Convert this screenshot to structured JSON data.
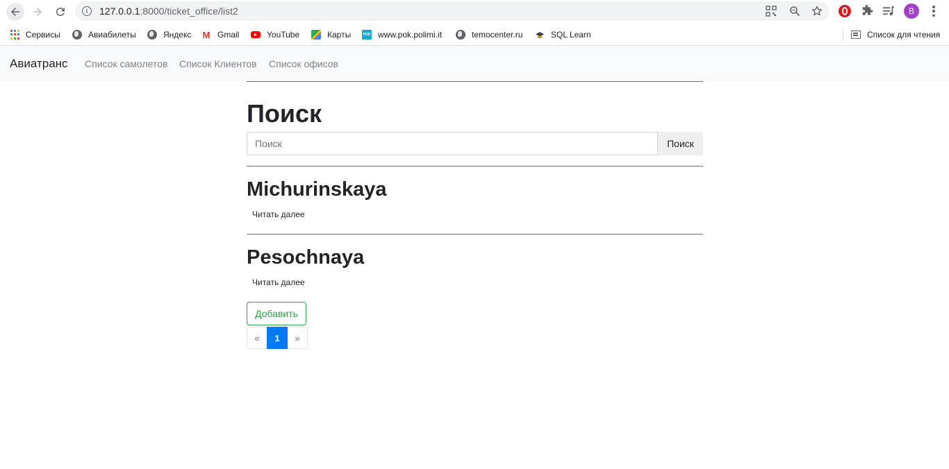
{
  "browser": {
    "url_host": "127.0.0.1",
    "url_path": ":8000/ticket_office/list2",
    "profile_initial": "B",
    "icons": [
      "back-icon",
      "forward-icon",
      "reload-icon",
      "info-icon",
      "qr-code-icon",
      "zoom-icon",
      "star-icon",
      "opera-icon",
      "extensions-icon",
      "media-icon",
      "menu-icon"
    ]
  },
  "bookmarks": [
    {
      "label": "Сервисы",
      "icon": "apps-grid-icon"
    },
    {
      "label": "Авиабилеты",
      "icon": "globe-icon"
    },
    {
      "label": "Яндекс",
      "icon": "globe-icon"
    },
    {
      "label": "Gmail",
      "icon": "gmail-icon"
    },
    {
      "label": "YouTube",
      "icon": "youtube-icon"
    },
    {
      "label": "Карты",
      "icon": "maps-icon"
    },
    {
      "label": "www.pok.polimi.it",
      "icon": "pok-icon",
      "icon_text": "POK"
    },
    {
      "label": "temocenter.ru",
      "icon": "globe-icon"
    },
    {
      "label": "SQL Learn",
      "icon": "graduation-cap-icon"
    }
  ],
  "reading_list": {
    "label": "Список для чтения",
    "icon": "reading-list-icon"
  },
  "navbar": {
    "brand": "Авиатранс",
    "links": [
      "Список самолетов",
      "Список Клиентов",
      "Список офисов"
    ]
  },
  "page": {
    "title": "Поиск",
    "search_placeholder": "Поиск",
    "search_button": "Поиск",
    "offices": [
      {
        "name": "Michurinskaya",
        "link": "Читать далее"
      },
      {
        "name": "Pesochnaya",
        "link": "Читать далее"
      }
    ],
    "add_button": "Добавить",
    "pagination": {
      "prev": "«",
      "current": "1",
      "next": "»"
    }
  },
  "colors": {
    "navbar_bg": "#f8f9fa",
    "success": "#28a745",
    "primary": "#007bff",
    "profile": "#a142c9"
  }
}
